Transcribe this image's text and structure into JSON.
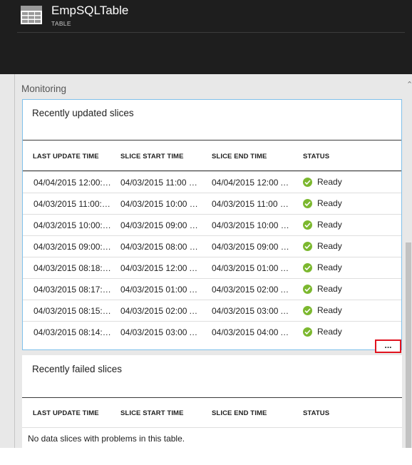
{
  "header": {
    "title": "EmpSQLTable",
    "subtitle": "TABLE",
    "icon": "table-icon"
  },
  "monitoring": {
    "label": "Monitoring"
  },
  "columns": {
    "last_update": "LAST UPDATE TIME",
    "slice_start": "SLICE START TIME",
    "slice_end": "SLICE END TIME",
    "status": "STATUS"
  },
  "recently_updated": {
    "title": "Recently updated slices",
    "rows": [
      {
        "last_update": "04/04/2015 12:00:4…",
        "slice_start": "04/03/2015 11:00 P…",
        "slice_end": "04/04/2015 12:00 A…",
        "status": "Ready"
      },
      {
        "last_update": "04/03/2015 11:00:0…",
        "slice_start": "04/03/2015 10:00 P…",
        "slice_end": "04/03/2015 11:00 P…",
        "status": "Ready"
      },
      {
        "last_update": "04/03/2015 10:00:4…",
        "slice_start": "04/03/2015 09:00 P…",
        "slice_end": "04/03/2015 10:00 P…",
        "status": "Ready"
      },
      {
        "last_update": "04/03/2015 09:00:4…",
        "slice_start": "04/03/2015 08:00 P…",
        "slice_end": "04/03/2015 09:00 P…",
        "status": "Ready"
      },
      {
        "last_update": "04/03/2015 08:18:0…",
        "slice_start": "04/03/2015 12:00 A…",
        "slice_end": "04/03/2015 01:00 A…",
        "status": "Ready"
      },
      {
        "last_update": "04/03/2015 08:17:0…",
        "slice_start": "04/03/2015 01:00 A…",
        "slice_end": "04/03/2015 02:00 A…",
        "status": "Ready"
      },
      {
        "last_update": "04/03/2015 08:15:5…",
        "slice_start": "04/03/2015 02:00 A…",
        "slice_end": "04/03/2015 03:00 A…",
        "status": "Ready"
      },
      {
        "last_update": "04/03/2015 08:14:5…",
        "slice_start": "04/03/2015 03:00 A…",
        "slice_end": "04/03/2015 04:00 A…",
        "status": "Ready"
      }
    ],
    "more_label": "..."
  },
  "recently_failed": {
    "title": "Recently failed slices",
    "empty_message": "No data slices with problems in this table."
  },
  "colors": {
    "header_bg": "#1e1e1e",
    "content_bg": "#e8e8e8",
    "panel_border": "#7fc0ea",
    "ready_green": "#7cb82f",
    "highlight_red": "#e0131f"
  }
}
